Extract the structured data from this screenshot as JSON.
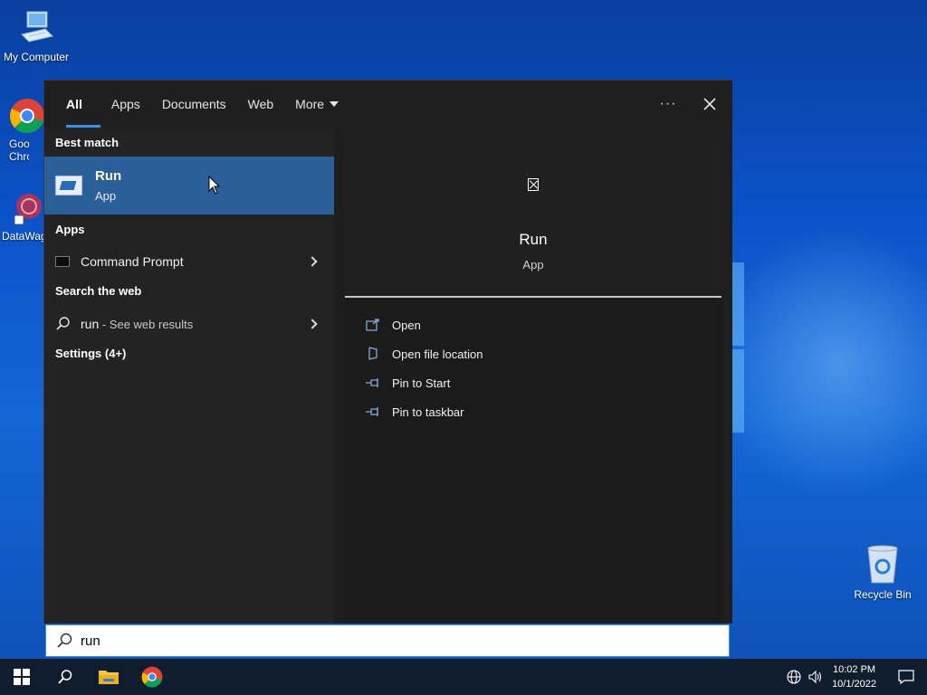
{
  "desktop": {
    "icons": [
      {
        "name": "my-computer",
        "label": "My Computer"
      },
      {
        "name": "google-chrome",
        "label": "Goog Chron"
      },
      {
        "name": "datawag",
        "label": "DataWag"
      },
      {
        "name": "recycle-bin",
        "label": "Recycle Bin"
      }
    ]
  },
  "search": {
    "tabs": [
      {
        "label": "All",
        "active": true
      },
      {
        "label": "Apps"
      },
      {
        "label": "Documents"
      },
      {
        "label": "Web"
      },
      {
        "label": "More"
      }
    ],
    "more_icon": "ellipsis-icon",
    "close_icon": "close-icon",
    "best_match_heading": "Best match",
    "best_match": {
      "title": "Run",
      "subtitle": "App"
    },
    "apps_heading": "Apps",
    "apps": [
      {
        "label": "Command Prompt"
      }
    ],
    "web_heading": "Search the web",
    "web_result": {
      "query": "run",
      "suffix": " - See web results"
    },
    "settings_heading": "Settings (4+)",
    "detail": {
      "title": "Run",
      "subtitle": "App",
      "actions": [
        {
          "label": "Open",
          "icon": "open-icon"
        },
        {
          "label": "Open file location",
          "icon": "file-location-icon"
        },
        {
          "label": "Pin to Start",
          "icon": "pin-icon"
        },
        {
          "label": "Pin to taskbar",
          "icon": "pin-icon"
        }
      ]
    },
    "query": "run"
  },
  "taskbar": {
    "time": "10:02 PM",
    "date": "10/1/2022"
  },
  "colors": {
    "accent": "#3a8ee6",
    "selected": "#2b5f9a",
    "panel": "#202020",
    "taskbar": "#101d2e"
  }
}
